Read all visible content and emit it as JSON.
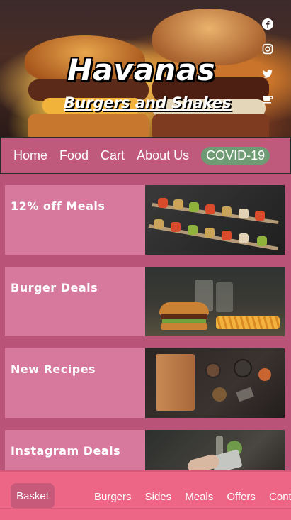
{
  "hero": {
    "brand": "Havanas",
    "tagline": "Burgers and Shakes",
    "social_icons": [
      "facebook-icon",
      "instagram-icon",
      "twitter-icon",
      "coffee-cup-icon"
    ]
  },
  "nav": {
    "items": [
      {
        "label": "Home"
      },
      {
        "label": "Food"
      },
      {
        "label": "Cart"
      },
      {
        "label": "About Us"
      },
      {
        "label": "COVID-19"
      }
    ],
    "covid_badge_color": "#6e9a74"
  },
  "cards": [
    {
      "label": "12% off Meals",
      "image": "grilled-kebab-skewers"
    },
    {
      "label": "Burger Deals",
      "image": "burger-with-fries"
    },
    {
      "label": "New Recipes",
      "image": "wooden-board-with-spices"
    },
    {
      "label": "Instagram Deals",
      "image": "phone-on-table"
    }
  ],
  "bottom_bar": {
    "basket_label": "Basket",
    "links": [
      "Burgers",
      "Sides",
      "Meals",
      "Offers",
      "Conta"
    ]
  },
  "colors": {
    "background": "#b95478",
    "nav": "#c05a7d",
    "card": "#d7799d",
    "bottom_bar": "#ed6686",
    "basket": "#c7597b"
  }
}
